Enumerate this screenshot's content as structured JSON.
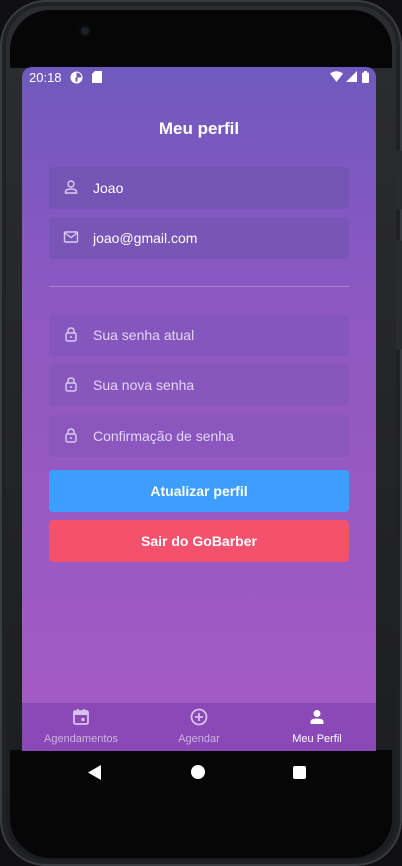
{
  "status_bar": {
    "time": "20:18"
  },
  "page": {
    "title": "Meu perfil"
  },
  "form": {
    "name": {
      "value": "Joao",
      "icon": "user-icon"
    },
    "email": {
      "value": "joao@gmail.com",
      "icon": "mail-icon"
    },
    "old_password": {
      "placeholder": "Sua senha atual",
      "icon": "lock-icon"
    },
    "new_password": {
      "placeholder": "Sua nova senha",
      "icon": "lock-icon"
    },
    "confirm_password": {
      "placeholder": "Confirmação de senha",
      "icon": "lock-icon"
    }
  },
  "buttons": {
    "update_label": "Atualizar perfil",
    "logout_label": "Sair do GoBarber"
  },
  "tabs": [
    {
      "label": "Agendamentos",
      "icon": "calendar-icon",
      "active": false
    },
    {
      "label": "Agendar",
      "icon": "plus-circle-icon",
      "active": false
    },
    {
      "label": "Meu Perfil",
      "icon": "person-icon",
      "active": true
    }
  ],
  "colors": {
    "update_button": "#3d9eff",
    "logout_button": "#f4516c",
    "tab_bar": "#8b48b7"
  }
}
